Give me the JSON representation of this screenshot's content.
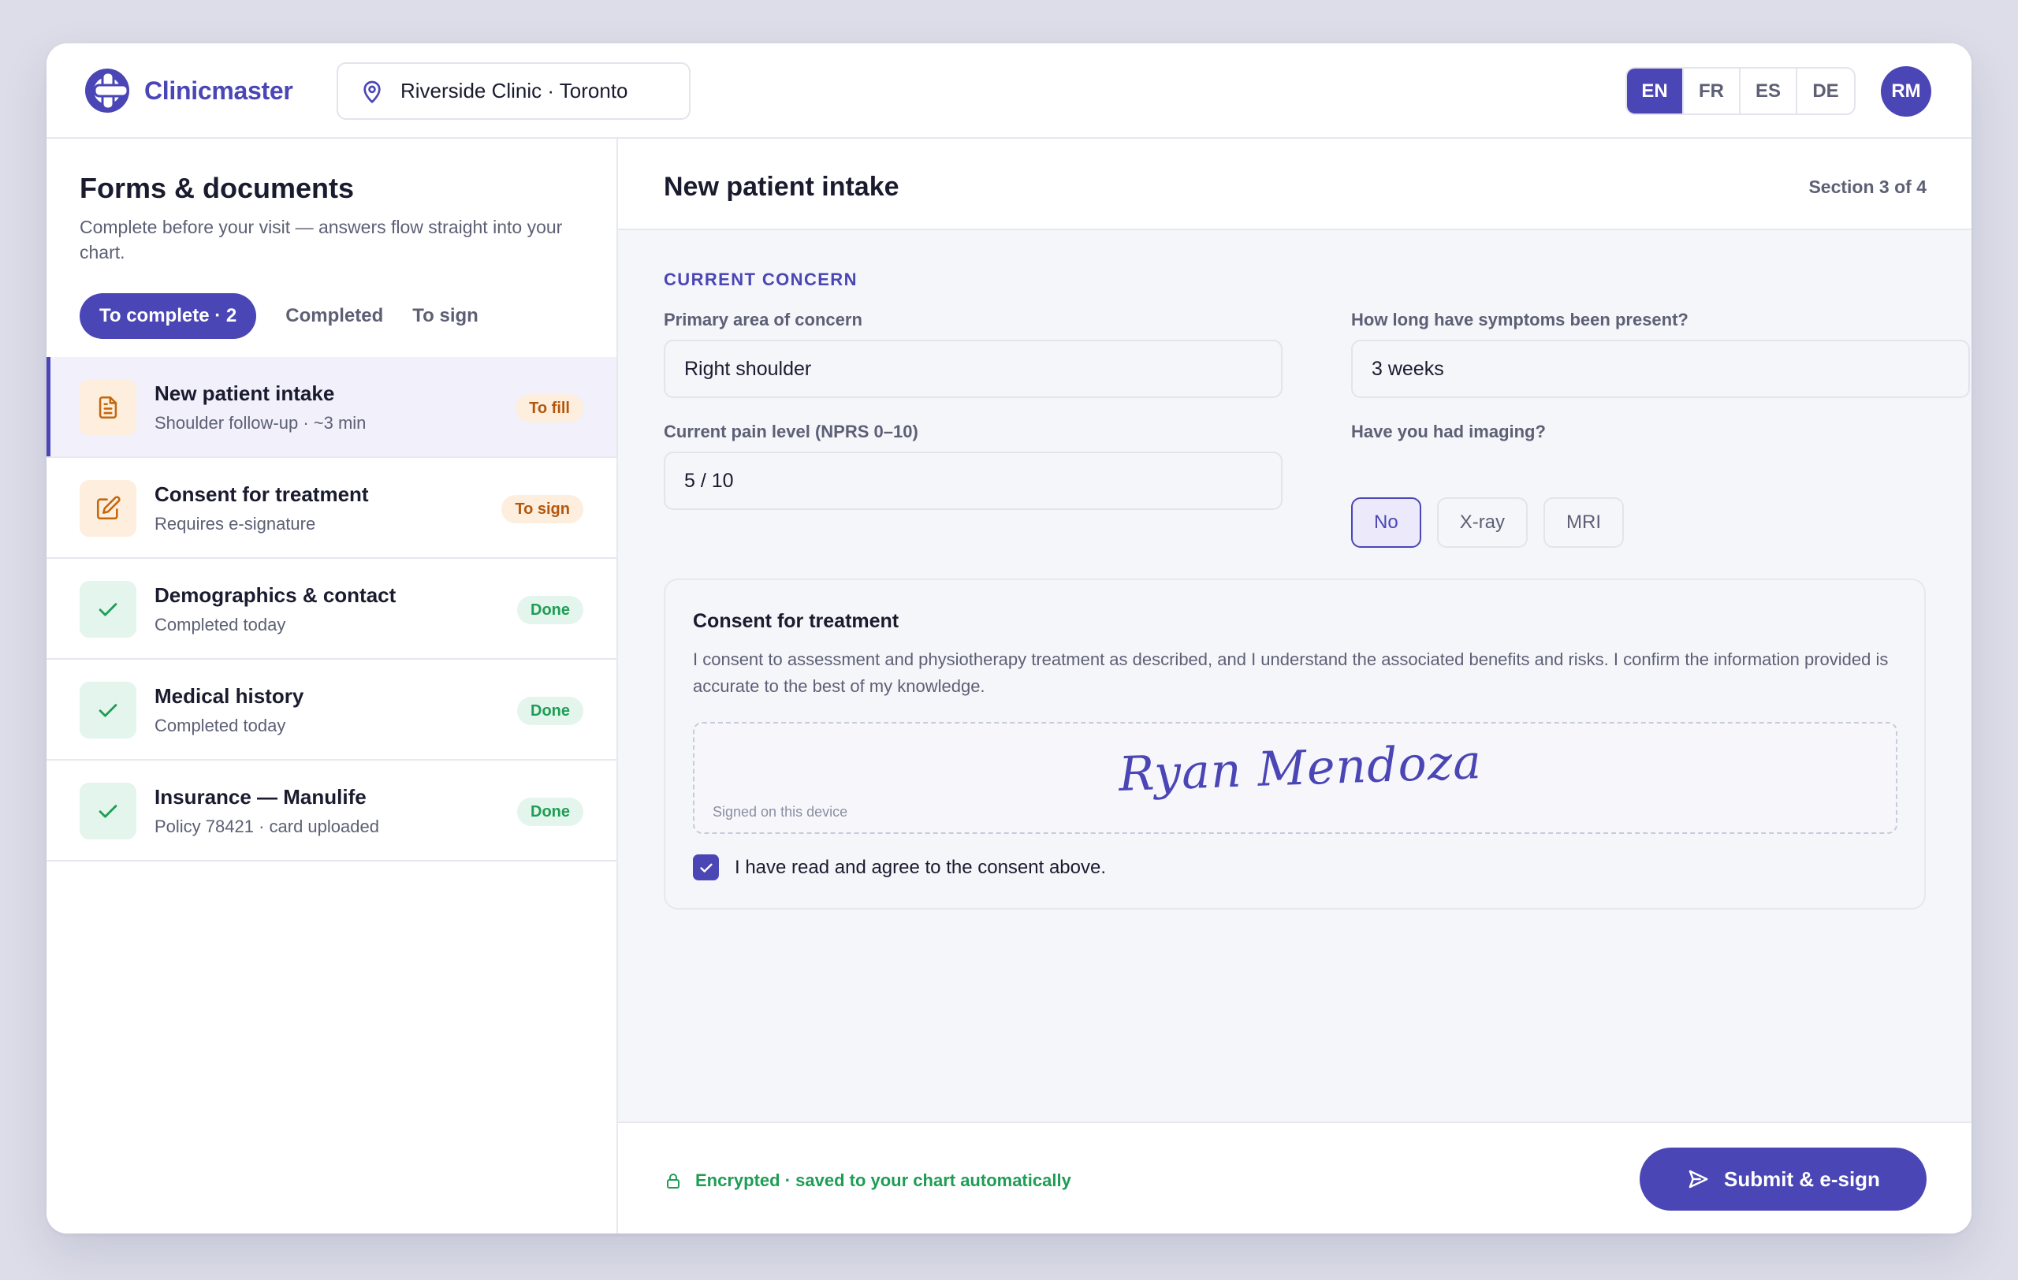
{
  "brand": {
    "name": "Clinicmaster"
  },
  "header": {
    "location": "Riverside Clinic · Toronto",
    "languages": [
      "EN",
      "FR",
      "ES",
      "DE"
    ],
    "active_language": "EN",
    "avatar_initials": "RM"
  },
  "sidebar": {
    "title": "Forms & documents",
    "subtitle": "Complete before your visit — answers flow straight into your chart.",
    "tabs": [
      {
        "label": "To complete · 2",
        "active": true
      },
      {
        "label": "Completed",
        "active": false
      },
      {
        "label": "To sign",
        "active": false
      }
    ],
    "documents": [
      {
        "title": "New patient intake",
        "meta": "Shoulder follow-up · ~3 min",
        "badge": "To fill",
        "icon": "document-icon",
        "selected": true
      },
      {
        "title": "Consent for treatment",
        "meta": "Requires e-signature",
        "badge": "To sign",
        "icon": "edit-icon",
        "selected": false
      },
      {
        "title": "Demographics & contact",
        "meta": "Completed today",
        "badge": "Done",
        "icon": "check-icon",
        "selected": false
      },
      {
        "title": "Medical history",
        "meta": "Completed today",
        "badge": "Done",
        "icon": "check-icon",
        "selected": false
      },
      {
        "title": "Insurance — Manulife",
        "meta": "Policy 78421 · card uploaded",
        "badge": "Done",
        "icon": "check-icon",
        "selected": false
      }
    ]
  },
  "main": {
    "title": "New patient intake",
    "section_indicator": "Section 3 of 4",
    "section_label": "CURRENT CONCERN",
    "fields": {
      "primary_area": {
        "label": "Primary area of concern",
        "value": "Right shoulder"
      },
      "duration": {
        "label": "How long have symptoms been present?",
        "value": "3 weeks"
      },
      "pain_level": {
        "label": "Current pain level (NPRS 0–10)",
        "value": "5 / 10"
      },
      "imaging": {
        "label": "Have you had imaging?",
        "options": [
          "No",
          "X-ray",
          "MRI"
        ],
        "selected": "No"
      }
    },
    "consent": {
      "title": "Consent for treatment",
      "body": "I consent to assessment and physiotherapy treatment as described, and I understand the associated benefits and risks. I confirm the information provided is accurate to the best of my knowledge.",
      "signature": "Ryan Mendoza",
      "signature_note": "Signed on this device",
      "agree_label": "I have read and agree to the consent above.",
      "agree_checked": true
    },
    "footer": {
      "secure_text": "Encrypted · saved to your chart automatically",
      "submit_label": "Submit & e-sign"
    }
  },
  "colors": {
    "accent": "#4b46b5",
    "orange": "#b4570b",
    "green": "#1f9d55",
    "background": "#dcdde8"
  }
}
